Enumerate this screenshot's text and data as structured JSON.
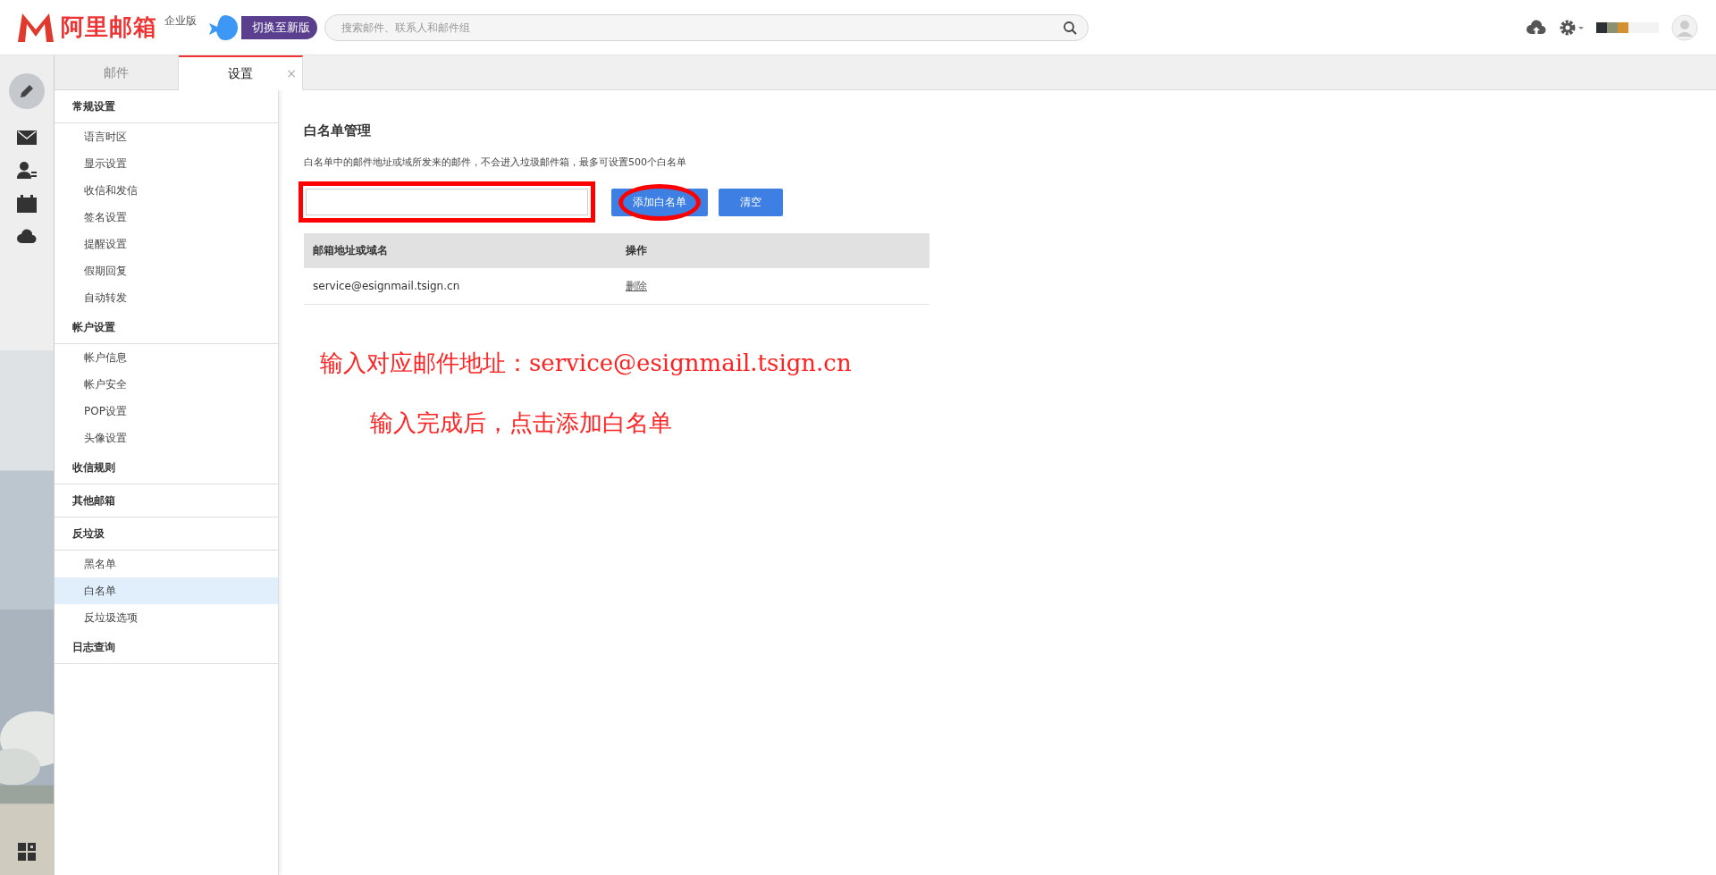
{
  "header": {
    "logo_text": "阿里邮箱",
    "edition": "企业版",
    "switch_button": "切换至新版",
    "search": {
      "placeholder": "搜索邮件、联系人和邮件组"
    }
  },
  "tabs": [
    {
      "label": "邮件",
      "selected": false
    },
    {
      "label": "设置",
      "selected": true,
      "close": "×"
    }
  ],
  "settings_nav": [
    {
      "label": "常规设置",
      "children": [
        {
          "label": "语言时区",
          "selected": false
        },
        {
          "label": "显示设置",
          "selected": false
        },
        {
          "label": "收信和发信",
          "selected": false
        },
        {
          "label": "签名设置",
          "selected": false
        },
        {
          "label": "提醒设置",
          "selected": false
        },
        {
          "label": "假期回复",
          "selected": false
        },
        {
          "label": "自动转发",
          "selected": false
        }
      ]
    },
    {
      "label": "帐户设置",
      "children": [
        {
          "label": "帐户信息",
          "selected": false
        },
        {
          "label": "帐户安全",
          "selected": false
        },
        {
          "label": "POP设置",
          "selected": false
        },
        {
          "label": "头像设置",
          "selected": false
        }
      ]
    },
    {
      "label": "收信规则"
    },
    {
      "label": "其他邮箱"
    },
    {
      "label": "反垃圾",
      "children": [
        {
          "label": "黑名单",
          "selected": false
        },
        {
          "label": "白名单",
          "selected": true
        },
        {
          "label": "反垃圾选项",
          "selected": false
        }
      ]
    },
    {
      "label": "日志查询"
    }
  ],
  "content": {
    "title": "白名单管理",
    "description": "白名单中的邮件地址或域所发来的邮件，不会进入垃圾邮件箱，最多可设置500个白名单",
    "input": {
      "framed": true
    },
    "buttons": [
      {
        "label": "添加白名单",
        "circled": true
      },
      {
        "label": "清空",
        "circled": false
      }
    ],
    "table": {
      "columns": [
        "邮箱地址或域名",
        "操作"
      ],
      "rows": [
        {
          "address": "service@esignmail.tsign.cn",
          "action": "删除"
        }
      ]
    }
  },
  "notes": [
    "输入对应邮件地址：service@esignmail.tsign.cn",
    "输入完成后，点击添加白名单"
  ]
}
